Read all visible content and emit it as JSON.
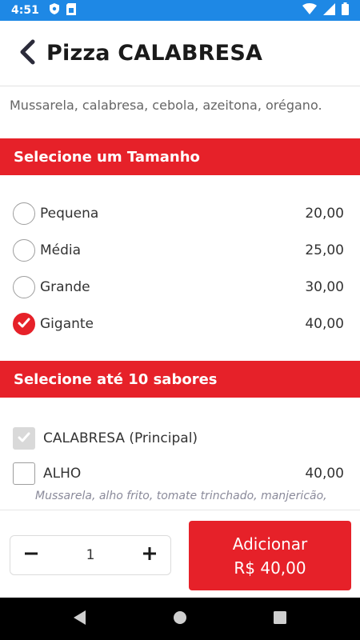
{
  "status_bar": {
    "time": "4:51"
  },
  "header": {
    "title": "Pizza CALABRESA"
  },
  "description": "Mussarela, calabresa, cebola, azeitona, orégano.",
  "size_section": {
    "title": "Selecione um Tamanho",
    "options": [
      {
        "label": "Pequena",
        "price": "20,00",
        "selected": false
      },
      {
        "label": "Média",
        "price": "25,00",
        "selected": false
      },
      {
        "label": "Grande",
        "price": "30,00",
        "selected": false
      },
      {
        "label": "Gigante",
        "price": "40,00",
        "selected": true
      }
    ]
  },
  "flavor_section": {
    "title": "Selecione até 10 sabores",
    "items": [
      {
        "label": "CALABRESA (Principal)",
        "price": "",
        "checked": true,
        "disabled": true
      },
      {
        "label": "ALHO",
        "price": "40,00",
        "checked": false,
        "disabled": false,
        "description": "Mussarela, alho frito, tomate trinchado, manjericão,"
      }
    ]
  },
  "footer": {
    "quantity": "1",
    "add_label": "Adicionar",
    "add_price": "R$ 40,00"
  },
  "colors": {
    "accent": "#e62129",
    "status_bar": "#1e88e5"
  },
  "icons": [
    "shield-icon",
    "sim-card-icon",
    "wifi-icon",
    "signal-icon",
    "battery-icon",
    "chevron-left-icon",
    "check-icon",
    "minus-icon",
    "plus-icon",
    "nav-back-icon",
    "nav-home-icon",
    "nav-recents-icon"
  ]
}
